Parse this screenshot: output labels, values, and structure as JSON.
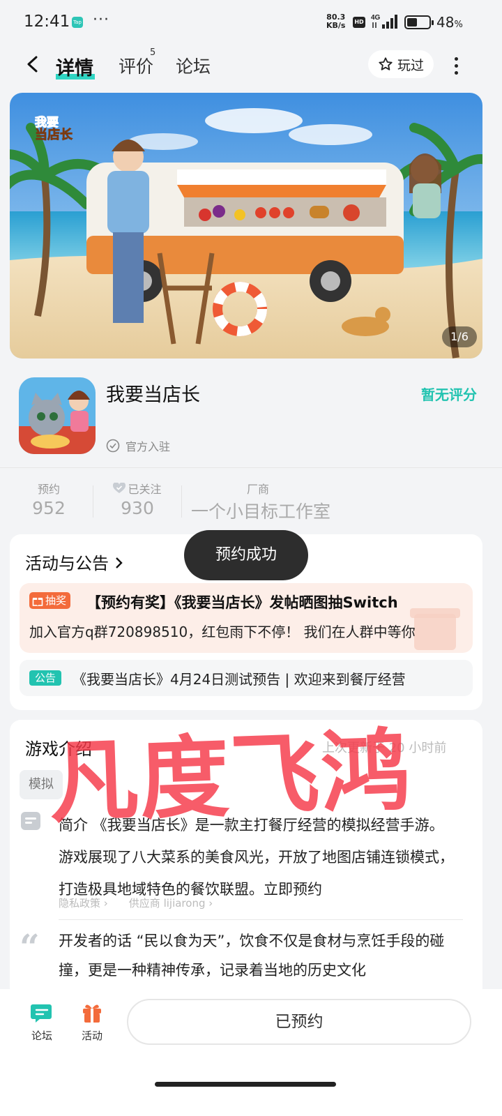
{
  "status_bar": {
    "time": "12:41",
    "app_badge": "Tap",
    "more": "···",
    "net_speed_value": "80.3",
    "net_speed_unit": "KB/s",
    "hd": "HD",
    "network": "4G",
    "battery": "48",
    "battery_unit": "%",
    "battery_level": 0.48
  },
  "nav": {
    "tabs": [
      "详情",
      "评价",
      "论坛"
    ],
    "review_count": "5",
    "played_label": "玩过"
  },
  "banner": {
    "pager": "1/6",
    "logo_line1": "我要",
    "logo_line2": "当店长"
  },
  "app": {
    "name": "我要当店长",
    "official": "官方入驻",
    "rating": "暂无评分"
  },
  "stats": [
    {
      "label": "预约",
      "value": "952"
    },
    {
      "label": "已关注",
      "value": "930"
    },
    {
      "label": "厂商",
      "value": "一个小目标工作室"
    }
  ],
  "activity": {
    "title": "活动与公告",
    "lottery_tag": "抽奖",
    "lottery_title": "【预约有奖】《我要当店长》发帖晒图抽Switch",
    "lottery_sub": "加入官方q群720898510，红包雨下不停！ 我们在人群中等你",
    "notice_tag": "公告",
    "notice_text": "《我要当店长》4月24日测试预告 | 欢迎来到餐厅经营"
  },
  "toast": "预约成功",
  "intro": {
    "title": "游戏介绍",
    "updated": "上次更新于 20 小时前",
    "chip": "模拟",
    "summary": "简介 《我要当店长》是一款主打餐厅经营的模拟经营手游。 游戏展现了八大菜系的美食风光，开放了地图店铺连锁模式，打造极具地域特色的餐饮联盟。立即预约",
    "privacy": "隐私政策",
    "vendor": "供应商 lijiarong",
    "dev_words": "开发者的话 “民以食为天”，饮食不仅是食材与烹饪手段的碰撞，更是一种精神传承，记录着当地的历史文化"
  },
  "watermark": "凡度飞鸿",
  "bottom": {
    "forum": "论坛",
    "activity": "活动",
    "reserved": "已预约"
  },
  "colors": {
    "accent": "#22c3b0",
    "prize": "#f36b3b",
    "watermark": "#f53848"
  }
}
